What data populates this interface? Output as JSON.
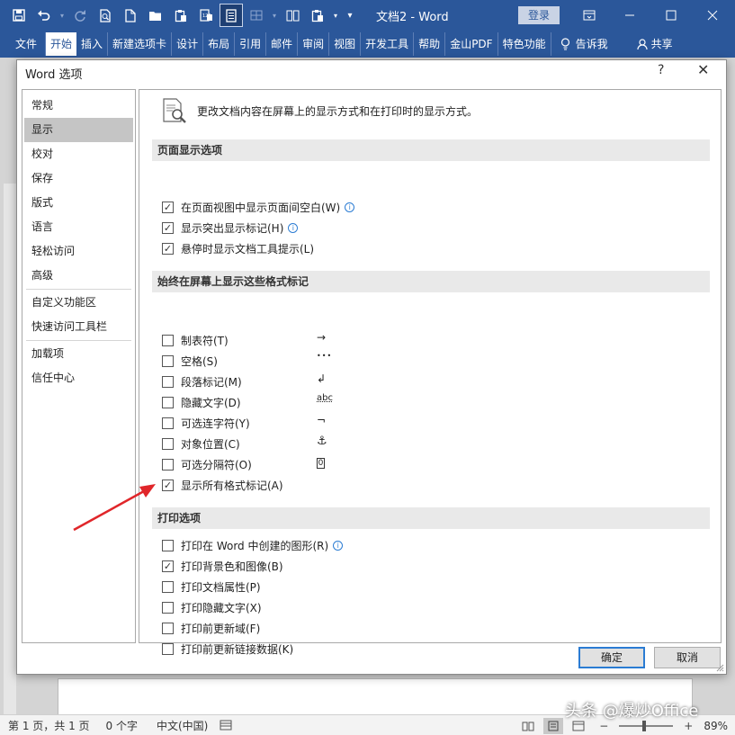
{
  "window": {
    "title": "文档2  -  Word",
    "login_label": "登录"
  },
  "qat_icons": [
    "save-icon",
    "undo-icon",
    "redo-icon",
    "print-preview-icon",
    "new-doc-icon",
    "open-icon",
    "paste-icon",
    "format-painter-icon",
    "read-mode-icon",
    "table-icon",
    "columns-icon",
    "paste-special-icon",
    "customize-qat-icon"
  ],
  "ribbon_tabs": [
    "文件",
    "开始",
    "插入",
    "新建选项卡",
    "设计",
    "布局",
    "引用",
    "邮件",
    "审阅",
    "视图",
    "开发工具",
    "帮助",
    "金山PDF",
    "特色功能",
    "告诉我",
    "共享"
  ],
  "dialog": {
    "title": "Word 选项",
    "help": "?",
    "close": "✕",
    "nav_items": [
      {
        "label": "常规"
      },
      {
        "label": "显示"
      },
      {
        "label": "校对"
      },
      {
        "label": "保存"
      },
      {
        "label": "版式"
      },
      {
        "label": "语言"
      },
      {
        "label": "轻松访问"
      },
      {
        "label": "高级"
      },
      {
        "label": "自定义功能区"
      },
      {
        "label": "快速访问工具栏"
      },
      {
        "label": "加载项"
      },
      {
        "label": "信任中心"
      }
    ],
    "intro_text": "更改文档内容在屏幕上的显示方式和在打印时的显示方式。",
    "sections": {
      "page_display": "页面显示选项",
      "format_marks": "始终在屏幕上显示这些格式标记",
      "print": "打印选项"
    },
    "page_display_options": [
      {
        "label": "在页面视图中显示页面间空白(W)",
        "checked": true,
        "info": true
      },
      {
        "label": "显示突出显示标记(H)",
        "checked": true,
        "info": true
      },
      {
        "label": "悬停时显示文档工具提示(L)",
        "checked": true,
        "info": false
      }
    ],
    "format_mark_options": [
      {
        "label": "制表符(T)",
        "checked": false,
        "symbol": "→"
      },
      {
        "label": "空格(S)",
        "checked": false,
        "symbol": "•••"
      },
      {
        "label": "段落标记(M)",
        "checked": false,
        "symbol": "↲"
      },
      {
        "label": "隐藏文字(D)",
        "checked": false,
        "symbol": "abc"
      },
      {
        "label": "可选连字符(Y)",
        "checked": false,
        "symbol": "¬"
      },
      {
        "label": "对象位置(C)",
        "checked": false,
        "symbol": "⚓"
      },
      {
        "label": "可选分隔符(O)",
        "checked": false,
        "symbol": "0"
      },
      {
        "label": "显示所有格式标记(A)",
        "checked": true,
        "symbol": ""
      }
    ],
    "print_options": [
      {
        "label": "打印在 Word 中创建的图形(R)",
        "checked": false,
        "info": true
      },
      {
        "label": "打印背景色和图像(B)",
        "checked": true,
        "info": false
      },
      {
        "label": "打印文档属性(P)",
        "checked": false,
        "info": false
      },
      {
        "label": "打印隐藏文字(X)",
        "checked": false,
        "info": false
      },
      {
        "label": "打印前更新域(F)",
        "checked": false,
        "info": false
      },
      {
        "label": "打印前更新链接数据(K)",
        "checked": false,
        "info": false
      }
    ],
    "ok_label": "确定",
    "cancel_label": "取消"
  },
  "status_bar": {
    "page": "第 1 页，共 1 页",
    "words": "0 个字",
    "language": "中文(中国)",
    "zoom": "89%"
  },
  "watermark": "头条 @爆炒Office",
  "colors": {
    "brand": "#2b579a",
    "accent_border": "#2b7cd3",
    "arrow": "#e0262a"
  }
}
